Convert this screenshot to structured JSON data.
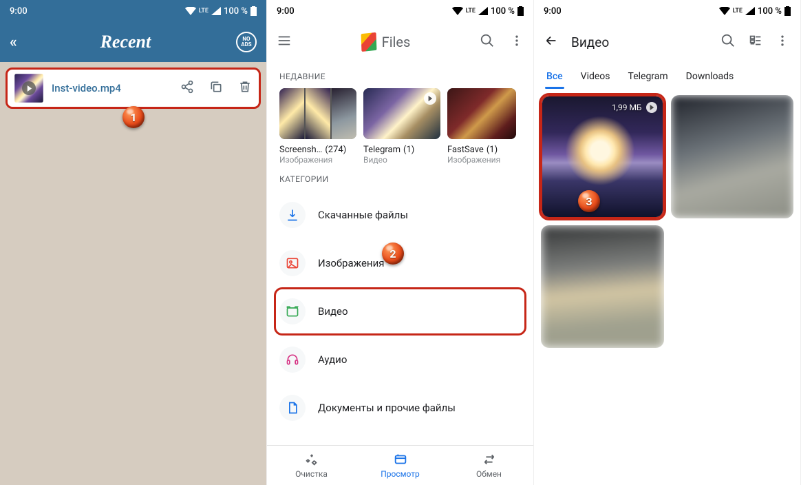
{
  "status": {
    "time": "9:00",
    "netlabel": "LTE",
    "battery": "100 %"
  },
  "screen1": {
    "title": "Recent",
    "noads": "NO ADS",
    "file": {
      "name": "Inst-video.mp4"
    }
  },
  "screen2": {
    "brand": "Files",
    "recentLabel": "НЕДАВНИЕ",
    "recent": [
      {
        "name": "Screensh…",
        "count": "(274)",
        "sub": "Изображения"
      },
      {
        "name": "Telegram",
        "count": "(1)",
        "sub": "Видео"
      },
      {
        "name": "FastSave",
        "count": "(1)",
        "sub": "Изображения"
      }
    ],
    "categoriesLabel": "КАТЕГОРИИ",
    "categories": {
      "downloads": "Скачанные файлы",
      "images": "Изображения",
      "video": "Видео",
      "audio": "Аудио",
      "docs": "Документы и прочие файлы"
    },
    "bottomnav": {
      "clean": "Очистка",
      "browse": "Просмотр",
      "share": "Обмен"
    }
  },
  "screen3": {
    "title": "Видео",
    "tabs": {
      "all": "Все",
      "videos": "Videos",
      "telegram": "Telegram",
      "downloads": "Downloads"
    },
    "tile1": {
      "size": "1,99 МБ"
    }
  },
  "callouts": {
    "one": "1",
    "two": "2",
    "three": "3"
  }
}
